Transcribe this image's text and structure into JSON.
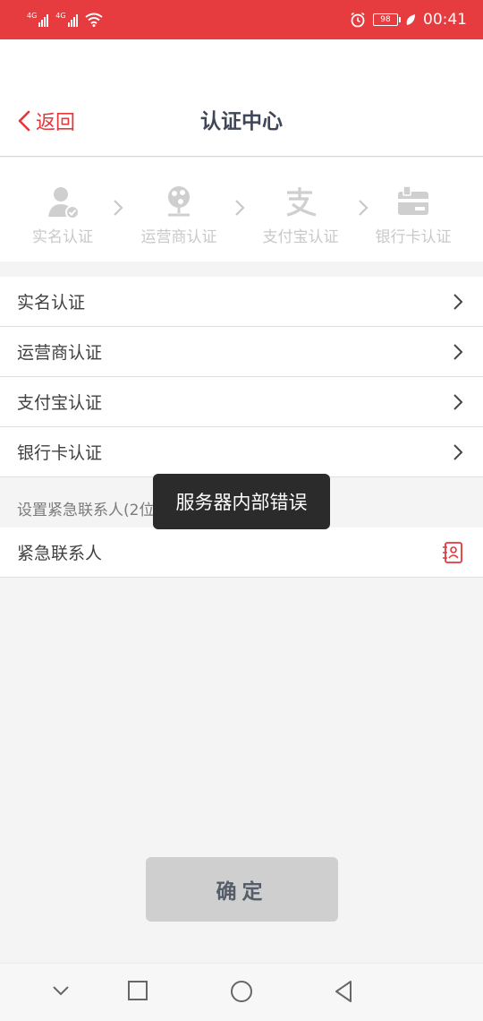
{
  "status_bar": {
    "network_1": "4G",
    "network_2": "4G",
    "battery": "98",
    "time": "00:41",
    "bg_color": "#e73c3f"
  },
  "header": {
    "back_label": "返回",
    "title": "认证中心"
  },
  "steps": [
    {
      "label": "实名认证",
      "icon": "user-verified-icon"
    },
    {
      "label": "运营商认证",
      "icon": "carrier-icon"
    },
    {
      "label": "支付宝认证",
      "icon": "alipay-icon"
    },
    {
      "label": "银行卡认证",
      "icon": "bank-card-icon"
    }
  ],
  "list": [
    {
      "label": "实名认证"
    },
    {
      "label": "运营商认证"
    },
    {
      "label": "支付宝认证"
    },
    {
      "label": "银行卡认证"
    }
  ],
  "emergency": {
    "hint": "设置紧急联系人(2位)",
    "contact_label": "紧急联系人"
  },
  "toast": "服务器内部错误",
  "confirm_label": "确定",
  "accent_color": "#e2383c"
}
